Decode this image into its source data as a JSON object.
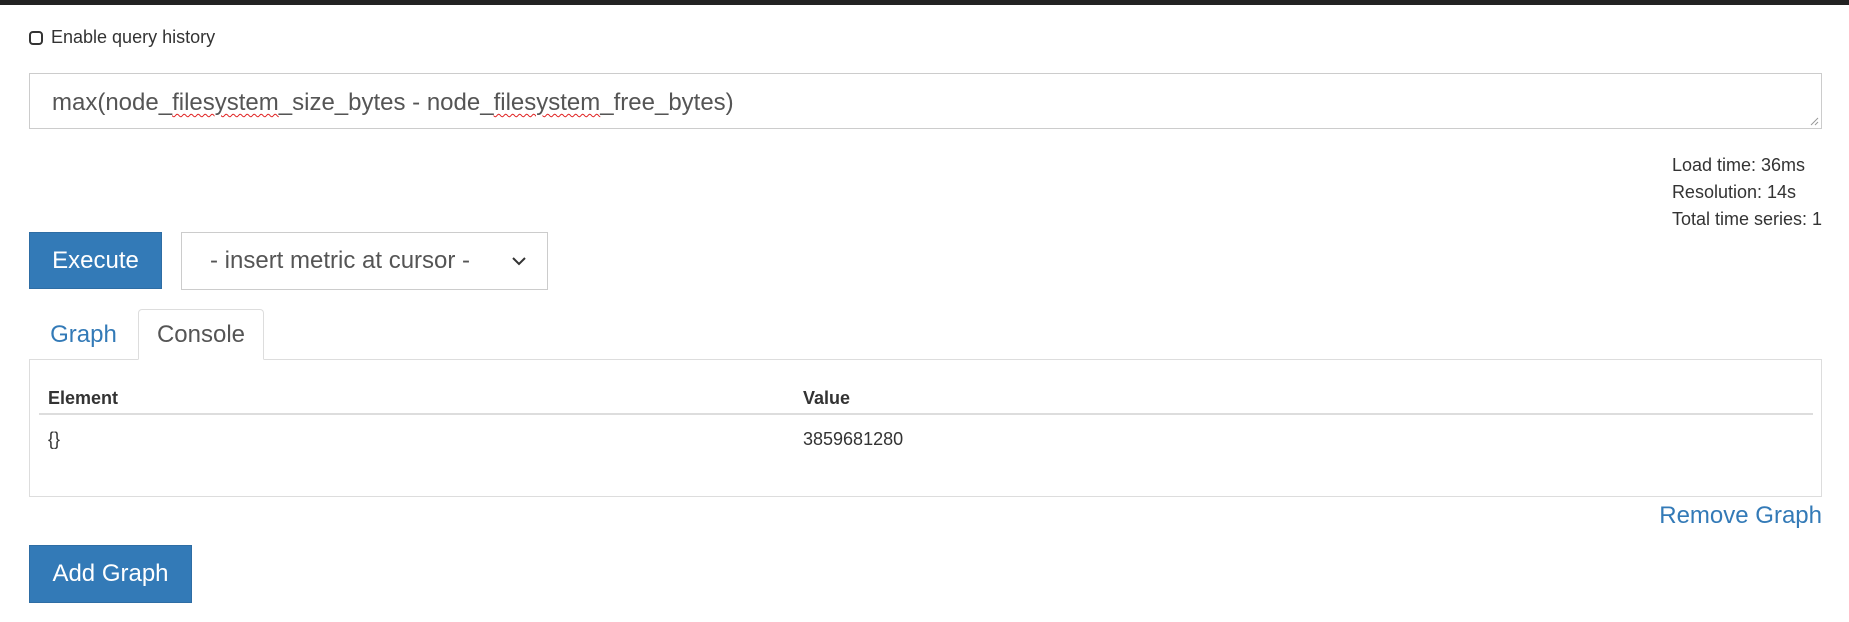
{
  "history": {
    "label": "Enable query history",
    "checked": false
  },
  "query": {
    "parts": [
      "max(node_",
      "filesystem",
      "_size_bytes - node_",
      "filesystem",
      "_free_bytes)"
    ]
  },
  "stats": {
    "load_time": "Load time: 36ms",
    "resolution": "Resolution: 14s",
    "total_series": "Total time series: 1"
  },
  "controls": {
    "execute_label": "Execute",
    "metric_select_value": "- insert metric at cursor -"
  },
  "tabs": [
    {
      "label": "Graph",
      "active": false
    },
    {
      "label": "Console",
      "active": true
    }
  ],
  "console_table": {
    "headers": [
      "Element",
      "Value"
    ],
    "rows": [
      {
        "element": "{}",
        "value": "3859681280"
      }
    ]
  },
  "actions": {
    "remove_graph_label": "Remove Graph",
    "add_graph_label": "Add Graph"
  },
  "colors": {
    "primary": "#337ab7",
    "topbar": "#222222",
    "border": "#dddddd",
    "spellcheck": "#e02020"
  }
}
